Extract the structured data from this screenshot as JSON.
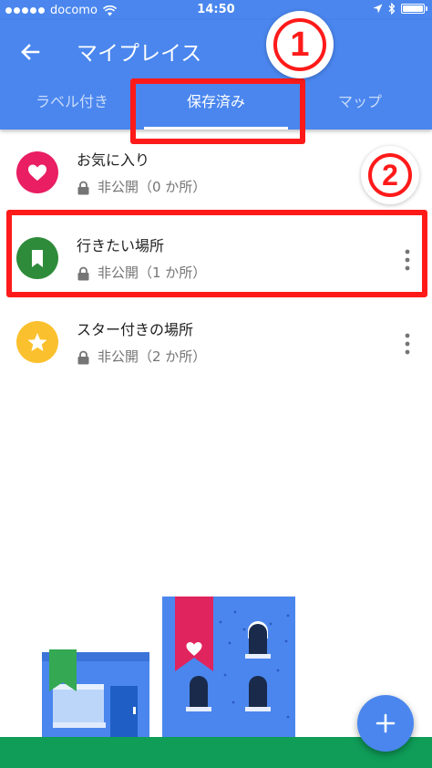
{
  "status_bar": {
    "carrier": "docomo",
    "time": "14:50"
  },
  "header": {
    "title": "マイプレイス",
    "tabs": [
      {
        "label": "ラベル付き",
        "active": false
      },
      {
        "label": "保存済み",
        "active": true
      },
      {
        "label": "マップ",
        "active": false
      }
    ]
  },
  "annotations": {
    "badge_1": "1",
    "badge_2": "2"
  },
  "lists": [
    {
      "title": "お気に入り",
      "visibility": "非公開（0 か所）",
      "icon": "heart-icon",
      "color": "#e91e63"
    },
    {
      "title": "行きたい場所",
      "visibility": "非公開（1 か所）",
      "icon": "flag-icon",
      "color": "#2e8b3a"
    },
    {
      "title": "スター付きの場所",
      "visibility": "非公開（2 か所）",
      "icon": "star-icon",
      "color": "#fbc02d"
    }
  ],
  "colors": {
    "primary": "#4a86ee",
    "annotation": "#ff1a1a",
    "ground": "#0f9d58"
  }
}
